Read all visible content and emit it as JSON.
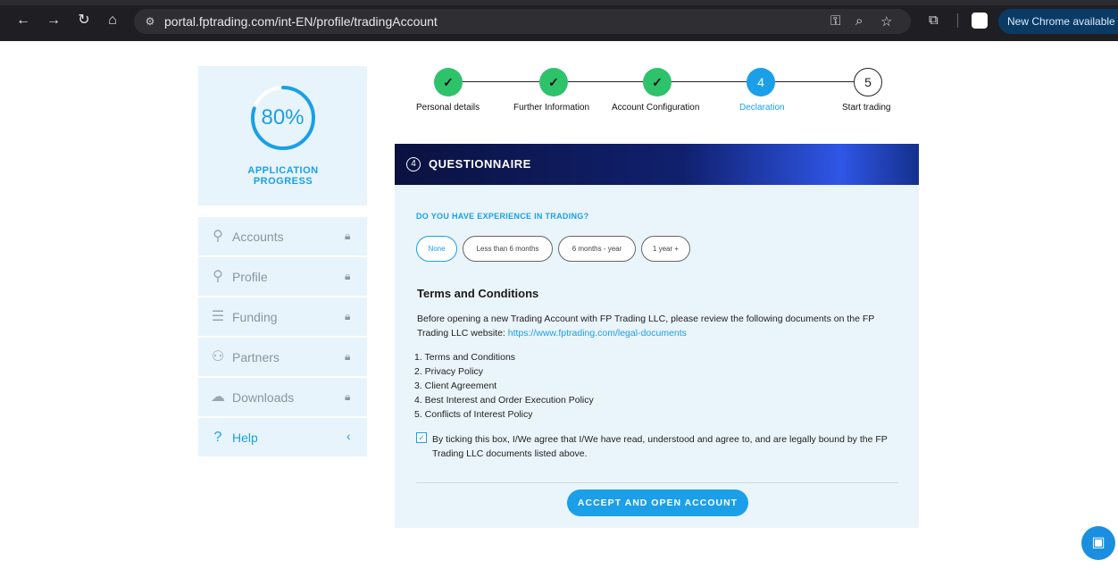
{
  "browser": {
    "url": "portal.fptrading.com/int-EN/profile/tradingAccount",
    "chrome_notice": "New Chrome available",
    "icons": [
      "back-icon",
      "forward-icon",
      "reload-icon",
      "home-icon",
      "site-settings-icon",
      "key-icon",
      "zoom-icon",
      "star-icon",
      "extensions-icon"
    ]
  },
  "progress": {
    "percent_text": "80%",
    "percent_value": 80,
    "label": "APPLICATION PROGRESS"
  },
  "menu": {
    "items": [
      {
        "label": "Accounts",
        "icon": "user-icon",
        "locked": true
      },
      {
        "label": "Profile",
        "icon": "user-plus-icon",
        "locked": true
      },
      {
        "label": "Funding",
        "icon": "coins-icon",
        "locked": true
      },
      {
        "label": "Partners",
        "icon": "partners-icon",
        "locked": true
      },
      {
        "label": "Downloads",
        "icon": "cloud-download-icon",
        "locked": true
      }
    ],
    "help": {
      "label": "Help",
      "icon": "help-circle-icon",
      "chevron": "‹"
    }
  },
  "stepper": {
    "steps": [
      {
        "label": "Personal details",
        "status": "done",
        "marker": "✓"
      },
      {
        "label": "Further Information",
        "status": "done",
        "marker": "✓"
      },
      {
        "label": "Account Configuration",
        "status": "done",
        "marker": "✓"
      },
      {
        "label": "Declaration",
        "status": "active",
        "marker": "4"
      },
      {
        "label": "Start trading",
        "status": "todo",
        "marker": "5"
      }
    ]
  },
  "questionnaire": {
    "number": "4",
    "title": "QUESTIONNAIRE",
    "question": "DO YOU HAVE EXPERIENCE IN TRADING?",
    "options": [
      "None",
      "Less than 6 months",
      "6 months - year",
      "1 year +"
    ],
    "selected": "None",
    "terms_title": "Terms and Conditions",
    "terms_intro": "Before opening a new Trading Account with FP Trading LLC, please review the following documents on the FP Trading LLC website:",
    "terms_link": "https://www.fptrading.com/legal-documents",
    "documents": [
      "1. Terms and Conditions",
      "2. Privacy Policy",
      "3. Client Agreement",
      "4. Best Interest and Order Execution Policy",
      "5. Conflicts of Interest Policy"
    ],
    "agree_text": "By ticking this box, I/We agree that I/We have read, understood and agree to, and are legally bound by the FP Trading LLC documents listed above.",
    "agree_checked": true,
    "accept_button": "ACCEPT AND OPEN ACCOUNT"
  },
  "colors": {
    "accent": "#1a9fe8",
    "done_green": "#2ec26b",
    "panel_bg": "#e8f4fb"
  }
}
